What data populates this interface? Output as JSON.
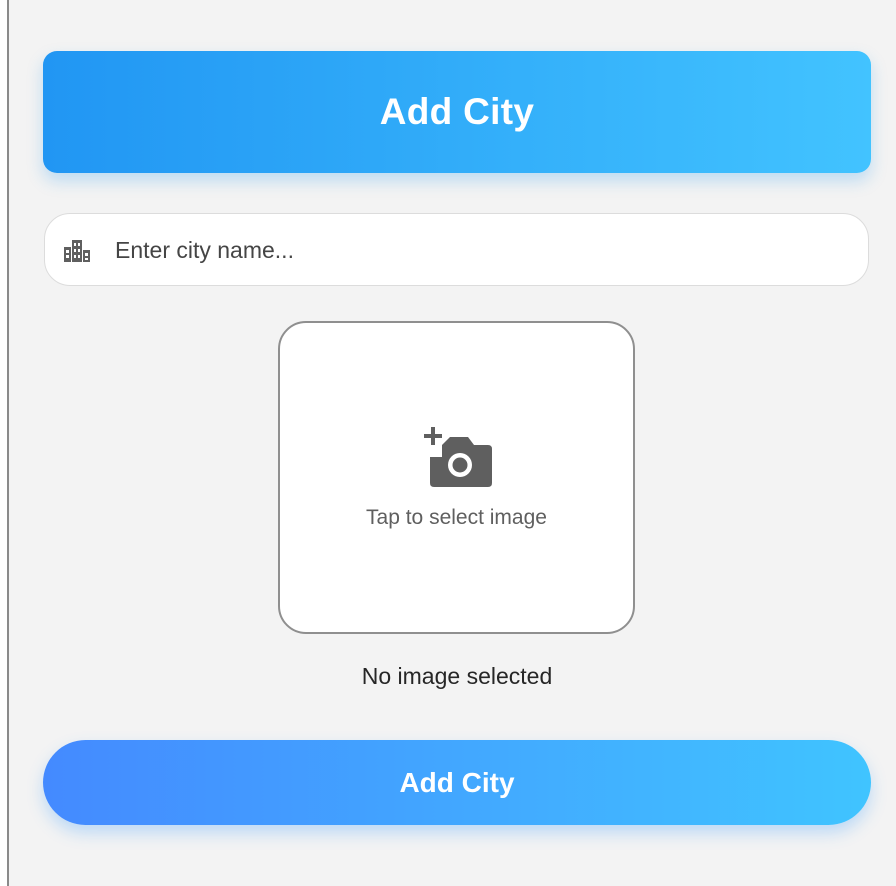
{
  "header": {
    "title": "Add City"
  },
  "city_input": {
    "placeholder": "Enter city name...",
    "value": "",
    "icon": "location-city-icon"
  },
  "image_picker": {
    "icon": "add-a-photo-icon",
    "label": "Tap to select image"
  },
  "status": {
    "image_status": "No image selected"
  },
  "submit": {
    "label": "Add City"
  },
  "colors": {
    "background": "#f3f3f3",
    "header_gradient_start": "#2196f3",
    "header_gradient_end": "#42c3ff",
    "button_gradient_start": "#448aff",
    "button_gradient_end": "#40c4ff",
    "icon": "#5f5f5f"
  }
}
